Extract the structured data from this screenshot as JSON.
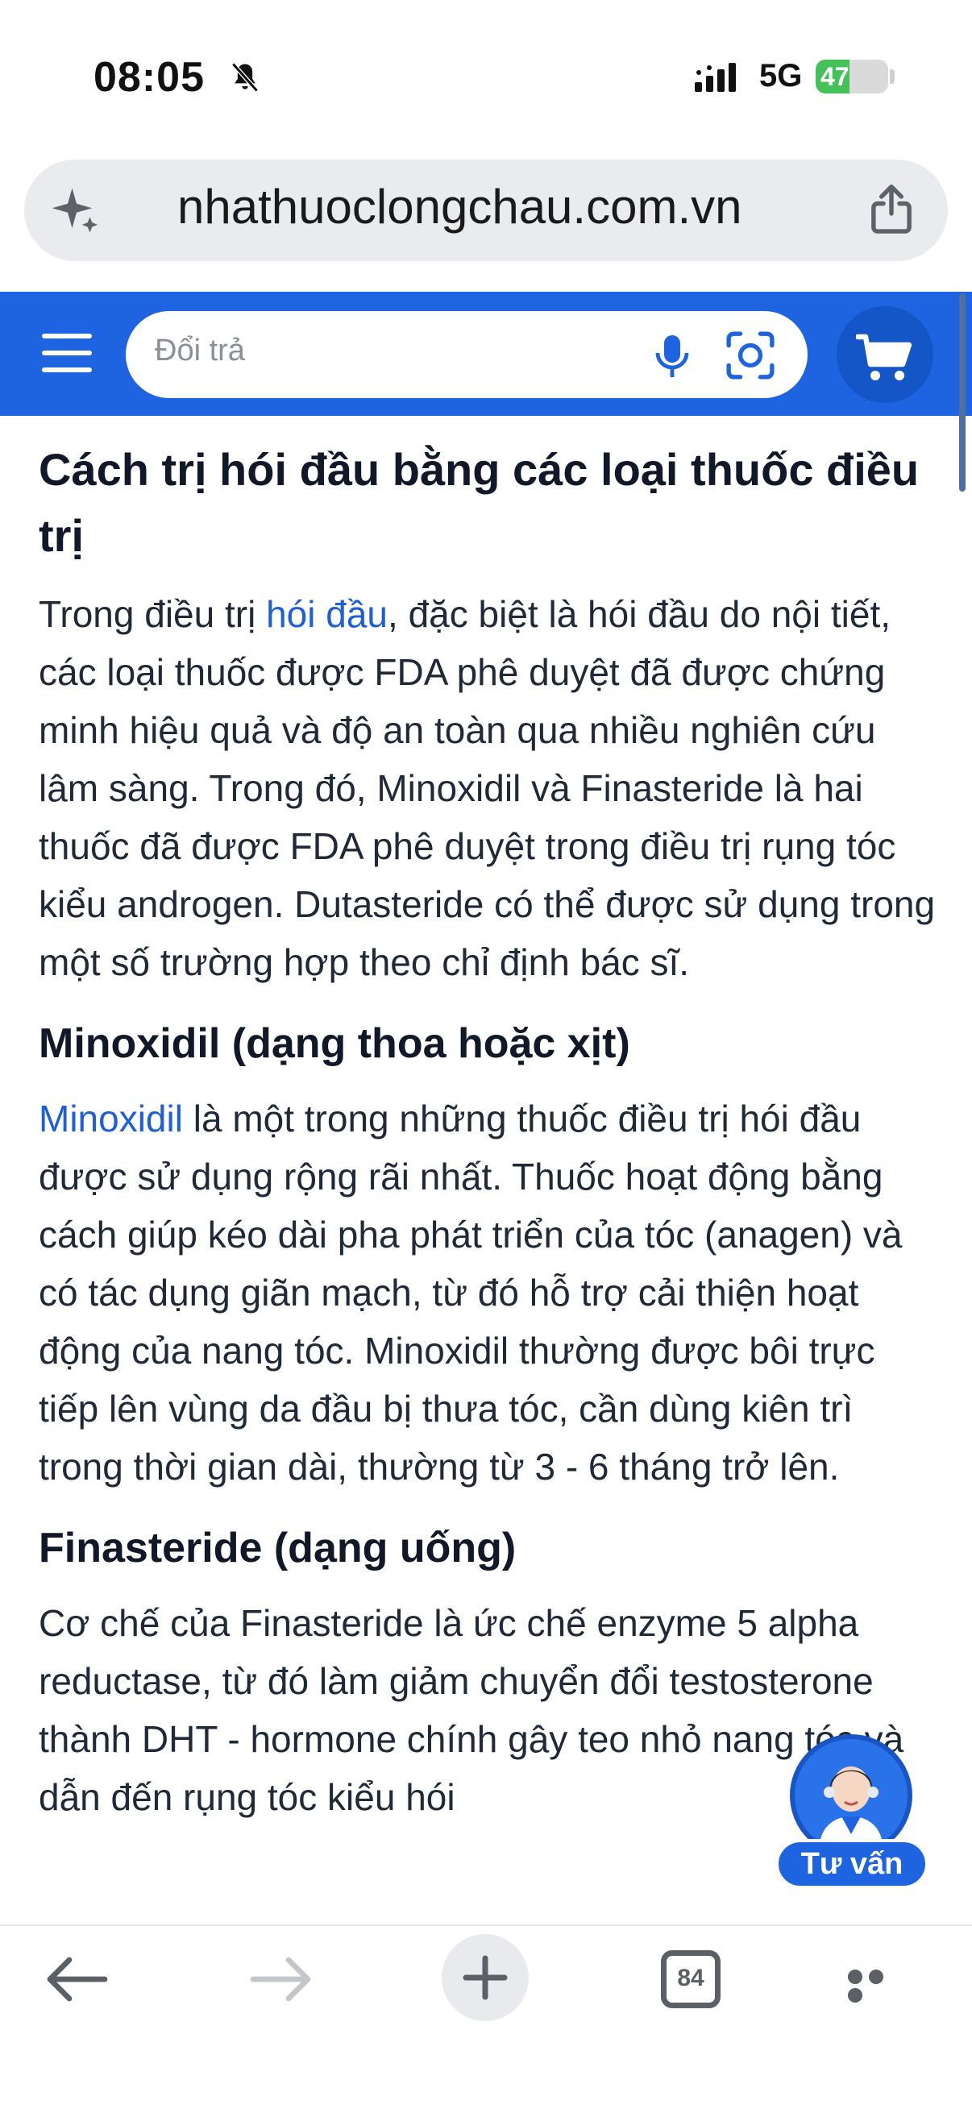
{
  "status_bar": {
    "time": "08:05",
    "network": "5G",
    "battery": "47",
    "battery_fraction": 0.47
  },
  "browser": {
    "url": "nhathuoclongchau.com.vn",
    "icons": [
      "sparkle-icon",
      "share-icon"
    ]
  },
  "header": {
    "search_placeholder": "Đổi trả",
    "icons": [
      "menu-icon",
      "microphone-icon",
      "scan-icon",
      "cart-icon"
    ],
    "brand_color": "#1e63e0"
  },
  "article": {
    "heading": "Cách trị hói đầu bằng các loại thuốc điều trị",
    "intro": {
      "before_link": "Trong điều trị ",
      "link": "hói đầu",
      "after_link": ", đặc biệt là hói đầu do nội tiết, các loại thuốc được FDA phê duyệt đã được chứng minh hiệu quả và độ an toàn qua nhiều nghiên cứu lâm sàng. Trong đó, Minoxidil và Finasteride là hai thuốc đã được FDA phê duyệt trong điều trị rụng tóc kiểu androgen. Dutasteride có thể được sử dụng trong một số trường hợp theo chỉ định bác sĩ."
    },
    "minoxidil": {
      "heading": "Minoxidil (dạng thoa hoặc xịt)",
      "link": "Minoxidil",
      "text": " là một trong những thuốc điều trị hói đầu được sử dụng rộng rãi nhất. Thuốc hoạt động bằng cách giúp kéo dài pha phát triển của tóc (anagen) và có tác dụng giãn mạch, từ đó hỗ trợ cải thiện hoạt động của nang tóc. Minoxidil thường được bôi trực tiếp lên vùng da đầu bị thưa tóc, cần dùng kiên trì trong thời gian dài, thường từ 3 - 6 tháng trở lên."
    },
    "finasteride": {
      "heading": "Finasteride (dạng uống)",
      "text": "Cơ chế của Finasteride là ức chế enzyme 5 alpha reductase, từ đó làm giảm chuyển đổi testosterone thành DHT - hormone chính gây teo nhỏ nang tóc và dẫn đến rụng tóc kiểu hói"
    },
    "link_color": "#1f5fd6"
  },
  "consult": {
    "label": "Tư vấn"
  },
  "toolbar": {
    "tab_count": "84",
    "icons": [
      "back-icon",
      "forward-icon",
      "new-tab-icon",
      "tabs-icon",
      "more-icon"
    ]
  }
}
